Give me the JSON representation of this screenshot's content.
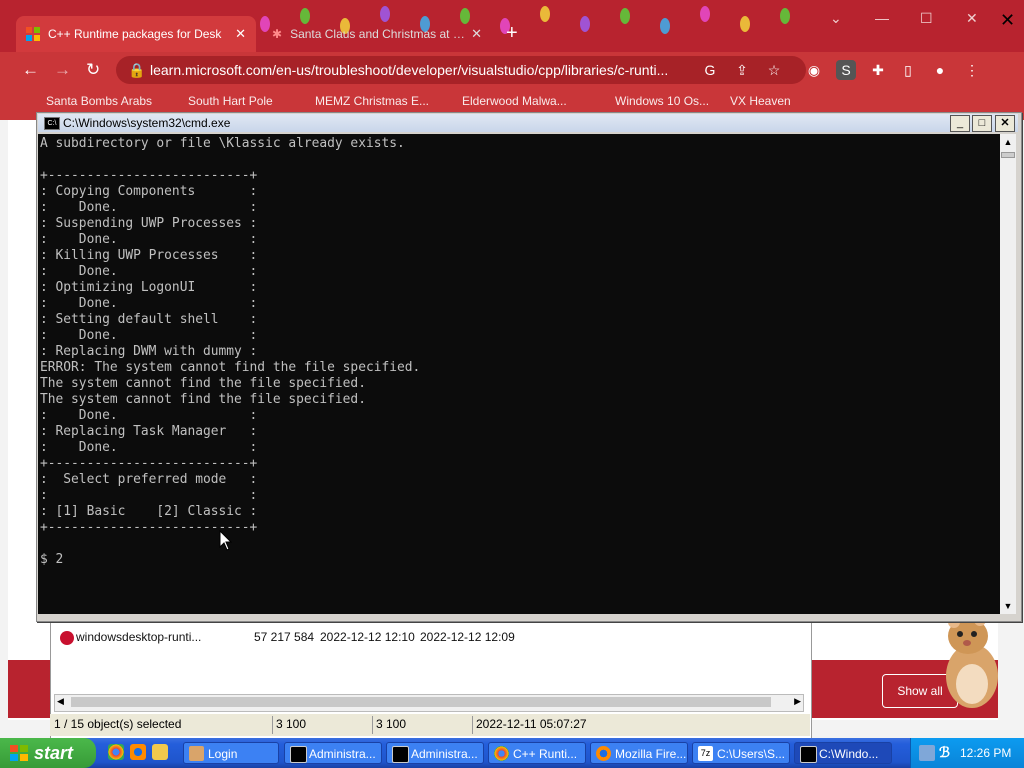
{
  "browser": {
    "tabs": [
      {
        "title": "C++ Runtime packages for Desk",
        "active": true
      },
      {
        "title": "Santa Claus and Christmas at the",
        "active": false
      }
    ],
    "url": "learn.microsoft.com/en-us/troubleshoot/developer/visualstudio/cpp/libraries/c-runti...",
    "bookmarks": [
      "Santa Bombs Arabs",
      "South Hart Pole",
      "MEMZ Christmas E...",
      "Elderwood Malwa...",
      "Windows 10 Os...",
      "VX Heaven"
    ],
    "extension_avatar": "S",
    "page_button": "Show all"
  },
  "cmd": {
    "title": "C:\\Windows\\system32\\cmd.exe",
    "lines": [
      "A subdirectory or file \\Klassic already exists.",
      "",
      "+--------------------------+",
      ": Copying Components       :",
      ":    Done.                 :",
      ": Suspending UWP Processes :",
      ":    Done.                 :",
      ": Killing UWP Processes    :",
      ":    Done.                 :",
      ": Optimizing LogonUI       :",
      ":    Done.                 :",
      ": Setting default shell    :",
      ":    Done.                 :",
      ": Replacing DWM with dummy :",
      "ERROR: The system cannot find the file specified.",
      "The system cannot find the file specified.",
      "The system cannot find the file specified.",
      ":    Done.                 :",
      ": Replacing Task Manager   :",
      ":    Done.                 :",
      "+--------------------------+",
      ":  Select preferred mode   :",
      ":                          :",
      ": [1] Basic    [2] Classic :",
      "+--------------------------+",
      "",
      "$ 2"
    ]
  },
  "file_window": {
    "row": {
      "name": "windowsdesktop-runti...",
      "size": "57 217 584",
      "modified": "2022-12-12 12:10",
      "created": "2022-12-12 12:09"
    },
    "status": {
      "selection": "1 / 15 object(s) selected",
      "size1": "3 100",
      "size2": "3 100",
      "date": "2022-12-11 05:07:27"
    }
  },
  "taskbar": {
    "start_label": "start",
    "buttons": [
      {
        "label": "Login",
        "active": false
      },
      {
        "label": "Administra...",
        "active": false
      },
      {
        "label": "Administra...",
        "active": false
      },
      {
        "label": "C++ Runti...",
        "active": false
      },
      {
        "label": "Mozilla Fire...",
        "active": false
      },
      {
        "label": "C:\\Users\\S...",
        "active": false
      },
      {
        "label": "C:\\Windo...",
        "active": true
      }
    ],
    "clock": "12:26 PM"
  },
  "colors": {
    "chrome_red": "#b8232f",
    "console_bg": "#0c0c0c",
    "console_text": "#c0c0c0",
    "taskbar_blue": "#245edb",
    "start_green": "#379b37"
  }
}
